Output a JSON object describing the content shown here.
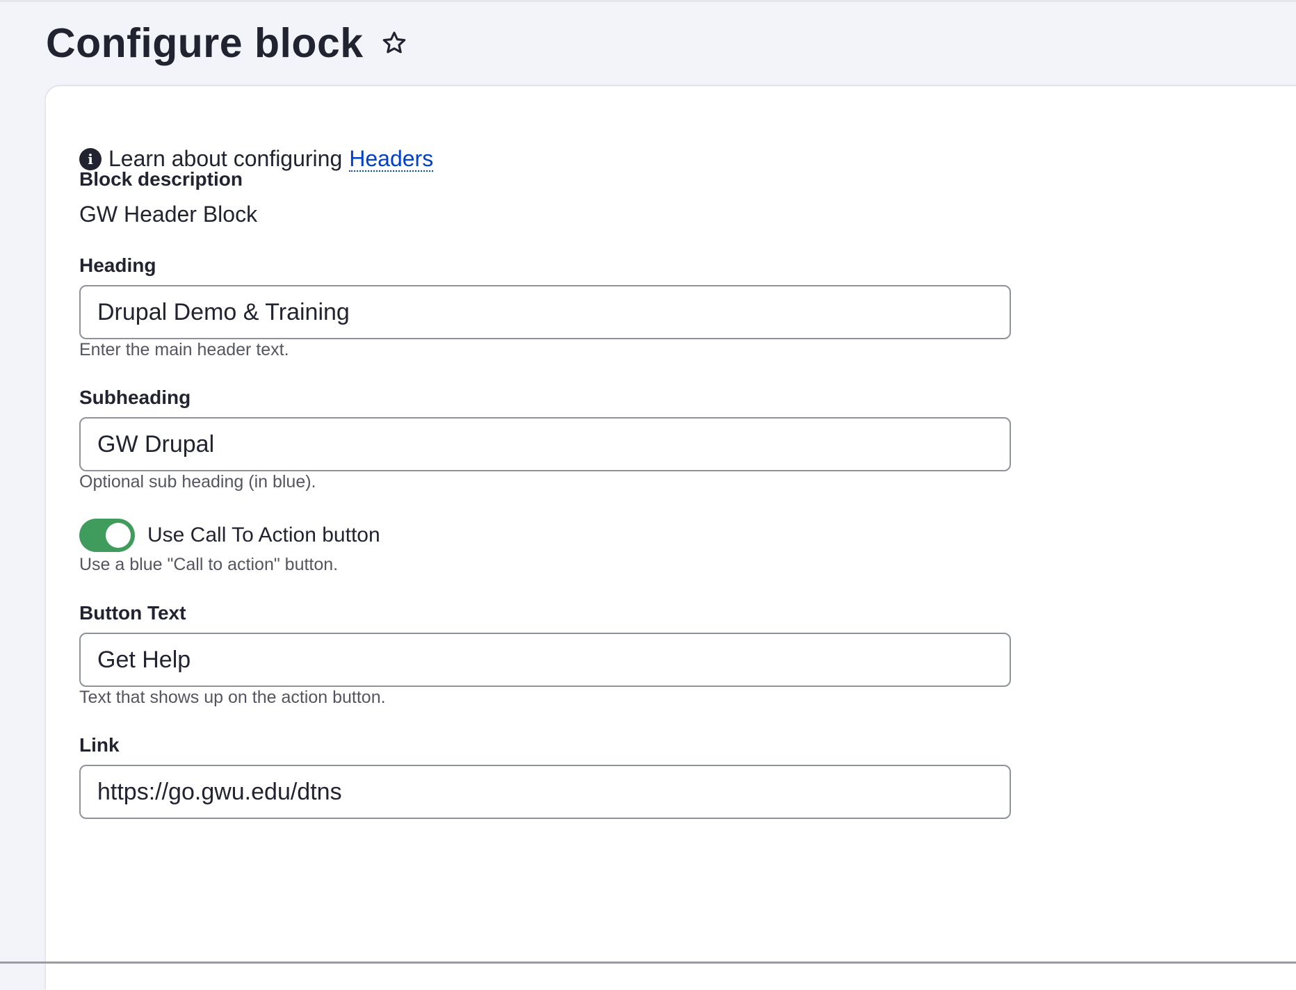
{
  "page": {
    "title": "Configure block",
    "star_icon": "star-outline-icon"
  },
  "info": {
    "icon": "info-icon",
    "icon_glyph": "i",
    "text": "Learn about configuring",
    "link_text": "Headers"
  },
  "block_description": {
    "label": "Block description",
    "value": "GW Header Block"
  },
  "heading": {
    "label": "Heading",
    "value": "Drupal Demo & Training",
    "help": "Enter the main header text."
  },
  "subheading": {
    "label": "Subheading",
    "value": "GW Drupal",
    "help": "Optional sub heading (in blue)."
  },
  "cta_toggle": {
    "label": "Use Call To Action button",
    "checked": true,
    "help": "Use a blue \"Call to action\" button.",
    "color": "#3f9c5c"
  },
  "button_text": {
    "label": "Button Text",
    "value": "Get Help",
    "help": "Text that shows up on the action button."
  },
  "link": {
    "label": "Link",
    "value": "https://go.gwu.edu/dtns"
  },
  "colors": {
    "link": "#003ecc",
    "text": "#222330",
    "toggle_on": "#3f9c5c"
  }
}
